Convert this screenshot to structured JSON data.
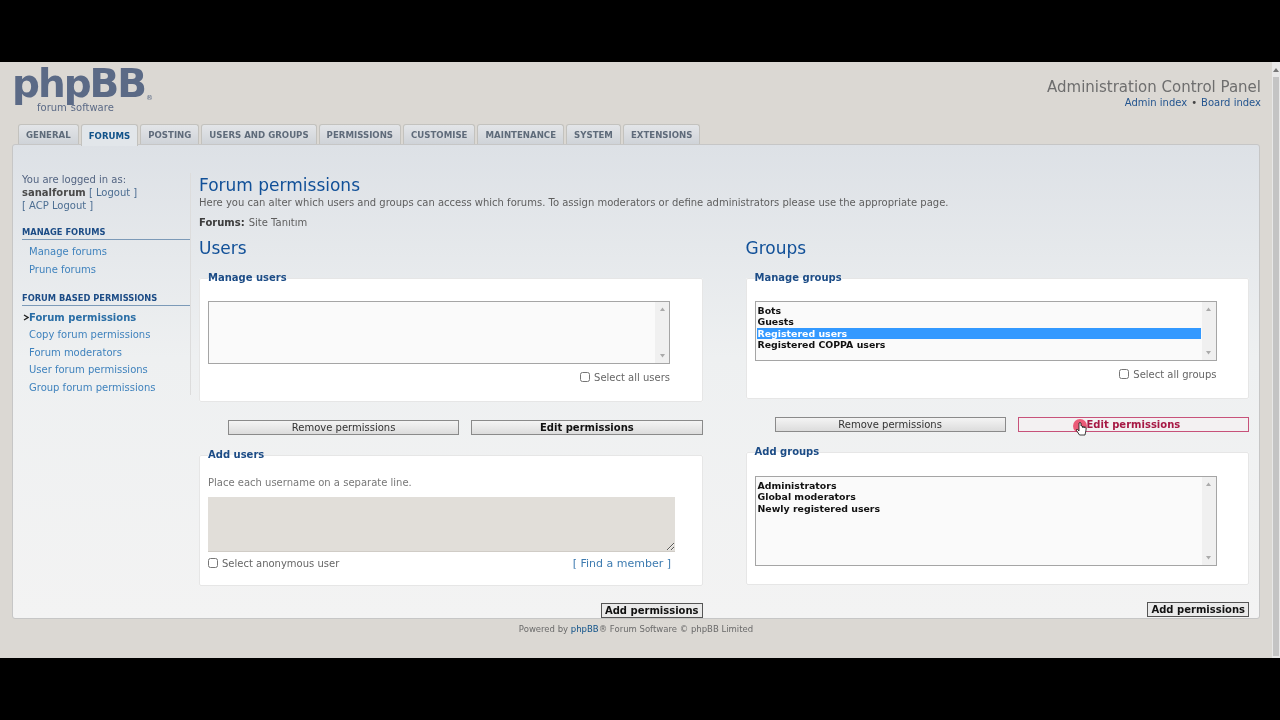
{
  "header": {
    "logo": {
      "wordmark": "phpBB",
      "mark": "®",
      "tagline_left": "forum",
      "tagline_right": "software"
    },
    "title": "Administration Control Panel",
    "links": [
      "Admin index",
      "Board index"
    ],
    "separator": "•"
  },
  "tabs": [
    {
      "label": "GENERAL",
      "selected": false
    },
    {
      "label": "FORUMS",
      "selected": true
    },
    {
      "label": "POSTING",
      "selected": false
    },
    {
      "label": "USERS AND GROUPS",
      "selected": false
    },
    {
      "label": "PERMISSIONS",
      "selected": false
    },
    {
      "label": "CUSTOMISE",
      "selected": false
    },
    {
      "label": "MAINTENANCE",
      "selected": false
    },
    {
      "label": "SYSTEM",
      "selected": false
    },
    {
      "label": "EXTENSIONS",
      "selected": false
    }
  ],
  "sidebar": {
    "login": {
      "label": "You are logged in as:",
      "user": "sanalforum",
      "logout": "[ Logout ]",
      "acp_logout": "[ ACP Logout ]"
    },
    "sections": [
      {
        "title": "MANAGE FORUMS",
        "items": [
          {
            "label": "Manage forums",
            "selected": false
          },
          {
            "label": "Prune forums",
            "selected": false
          }
        ]
      },
      {
        "title": "FORUM BASED PERMISSIONS",
        "items": [
          {
            "label": "Forum permissions",
            "selected": true
          },
          {
            "label": "Copy forum permissions",
            "selected": false
          },
          {
            "label": "Forum moderators",
            "selected": false
          },
          {
            "label": "User forum permissions",
            "selected": false
          },
          {
            "label": "Group forum permissions",
            "selected": false
          }
        ]
      }
    ]
  },
  "main": {
    "title": "Forum permissions",
    "description": "Here you can alter which users and groups can access which forums. To assign moderators or define administrators please use the appropriate page.",
    "forums_label": "Forums:",
    "forums_value": "Site Tanıtım",
    "columns": [
      {
        "heading": "Users",
        "manage": {
          "legend": "Manage users",
          "select_all": {
            "label": "Select all users",
            "checked": false
          }
        },
        "buttons": [
          {
            "label": "Remove permissions",
            "kind": "secondary",
            "hovered": false
          },
          {
            "label": "Edit permissions",
            "kind": "primary",
            "hovered": false
          }
        ],
        "add": {
          "legend": "Add users",
          "kind": "usernames",
          "hint": "Place each username on a separate line.",
          "anonymous": {
            "label": "Select anonymous user",
            "checked": false
          },
          "find_link": "[ Find a member ]"
        },
        "submit": "Add permissions"
      },
      {
        "heading": "Groups",
        "manage": {
          "legend": "Manage groups",
          "options": [
            {
              "label": "Bots",
              "selected": false
            },
            {
              "label": "Guests",
              "selected": false
            },
            {
              "label": "Registered users",
              "selected": true
            },
            {
              "label": "Registered COPPA users",
              "selected": false
            }
          ],
          "select_all": {
            "label": "Select all groups",
            "checked": false
          }
        },
        "buttons": [
          {
            "label": "Remove permissions",
            "kind": "secondary",
            "hovered": false
          },
          {
            "label": "Edit permissions",
            "kind": "primary",
            "hovered": true
          }
        ],
        "add": {
          "legend": "Add groups",
          "kind": "groups",
          "options": [
            {
              "label": "Administrators",
              "selected": false
            },
            {
              "label": "Global moderators",
              "selected": false
            },
            {
              "label": "Newly registered users",
              "selected": false
            }
          ]
        },
        "submit": "Add permissions"
      }
    ]
  },
  "cursor": {
    "kind": "hand",
    "clicking": true
  },
  "footer": {
    "before": "Powered by ",
    "link": "phpBB",
    "after": "® Forum Software © phpBB Limited"
  }
}
